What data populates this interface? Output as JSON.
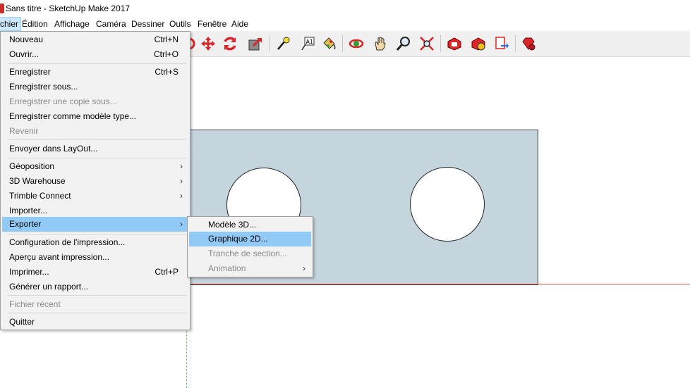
{
  "window": {
    "title": "Sans titre - SketchUp Make 2017"
  },
  "menubar": {
    "items": [
      "chier",
      "Édition",
      "Affichage",
      "Caméra",
      "Dessiner",
      "Outils",
      "Fenêtre",
      "Aide"
    ]
  },
  "toolbar": {
    "icons": [
      "rotate-icon",
      "move-icon",
      "follow-me-icon",
      "push-pull-icon",
      "tape-measure-icon",
      "text-label-icon",
      "paint-bucket-icon",
      "orbit-icon",
      "pan-icon",
      "zoom-icon",
      "zoom-extents-icon",
      "warehouse-icon",
      "extension-warehouse-icon",
      "layout-send-icon",
      "ruby-extension-icon"
    ]
  },
  "file_menu": {
    "items": [
      {
        "label": "Nouveau",
        "shortcut": "Ctrl+N",
        "disabled": false
      },
      {
        "label": "Ouvrir...",
        "shortcut": "Ctrl+O",
        "disabled": false
      },
      {
        "label": "Enregistrer",
        "shortcut": "Ctrl+S",
        "disabled": false
      },
      {
        "label": "Enregistrer sous...",
        "shortcut": "",
        "disabled": false
      },
      {
        "label": "Enregistrer une copie sous...",
        "shortcut": "",
        "disabled": true
      },
      {
        "label": "Enregistrer comme modèle type...",
        "shortcut": "",
        "disabled": false
      },
      {
        "label": "Revenir",
        "shortcut": "",
        "disabled": true
      },
      {
        "label": "Envoyer dans LayOut...",
        "shortcut": "",
        "disabled": false
      },
      {
        "label": "Géoposition",
        "shortcut": "",
        "disabled": false
      },
      {
        "label": "3D Warehouse",
        "shortcut": "",
        "disabled": false
      },
      {
        "label": "Trimble Connect",
        "shortcut": "",
        "disabled": false
      },
      {
        "label": "Importer...",
        "shortcut": "",
        "disabled": false
      },
      {
        "label": "Exporter",
        "shortcut": "",
        "disabled": false
      },
      {
        "label": "Configuration de l'impression...",
        "shortcut": "",
        "disabled": false
      },
      {
        "label": "Aperçu avant impression...",
        "shortcut": "",
        "disabled": false
      },
      {
        "label": "Imprimer...",
        "shortcut": "Ctrl+P",
        "disabled": false
      },
      {
        "label": "Générer un rapport...",
        "shortcut": "",
        "disabled": false
      },
      {
        "label": "Fichier récent",
        "shortcut": "",
        "disabled": true
      },
      {
        "label": "Quitter",
        "shortcut": "",
        "disabled": false
      }
    ]
  },
  "export_submenu": {
    "items": [
      {
        "label": "Modèle 3D...",
        "disabled": false
      },
      {
        "label": "Graphique 2D...",
        "disabled": false
      },
      {
        "label": "Tranche de section...",
        "disabled": true
      },
      {
        "label": "Animation",
        "disabled": true
      }
    ]
  },
  "arrow_glyph": "›",
  "colors": {
    "highlight": "#91c9f7",
    "menubar_active": "#cce8ff",
    "shape_fill": "#c5d5de",
    "red_axis": "#e05a5a",
    "green_axis": "#5fb85f"
  }
}
